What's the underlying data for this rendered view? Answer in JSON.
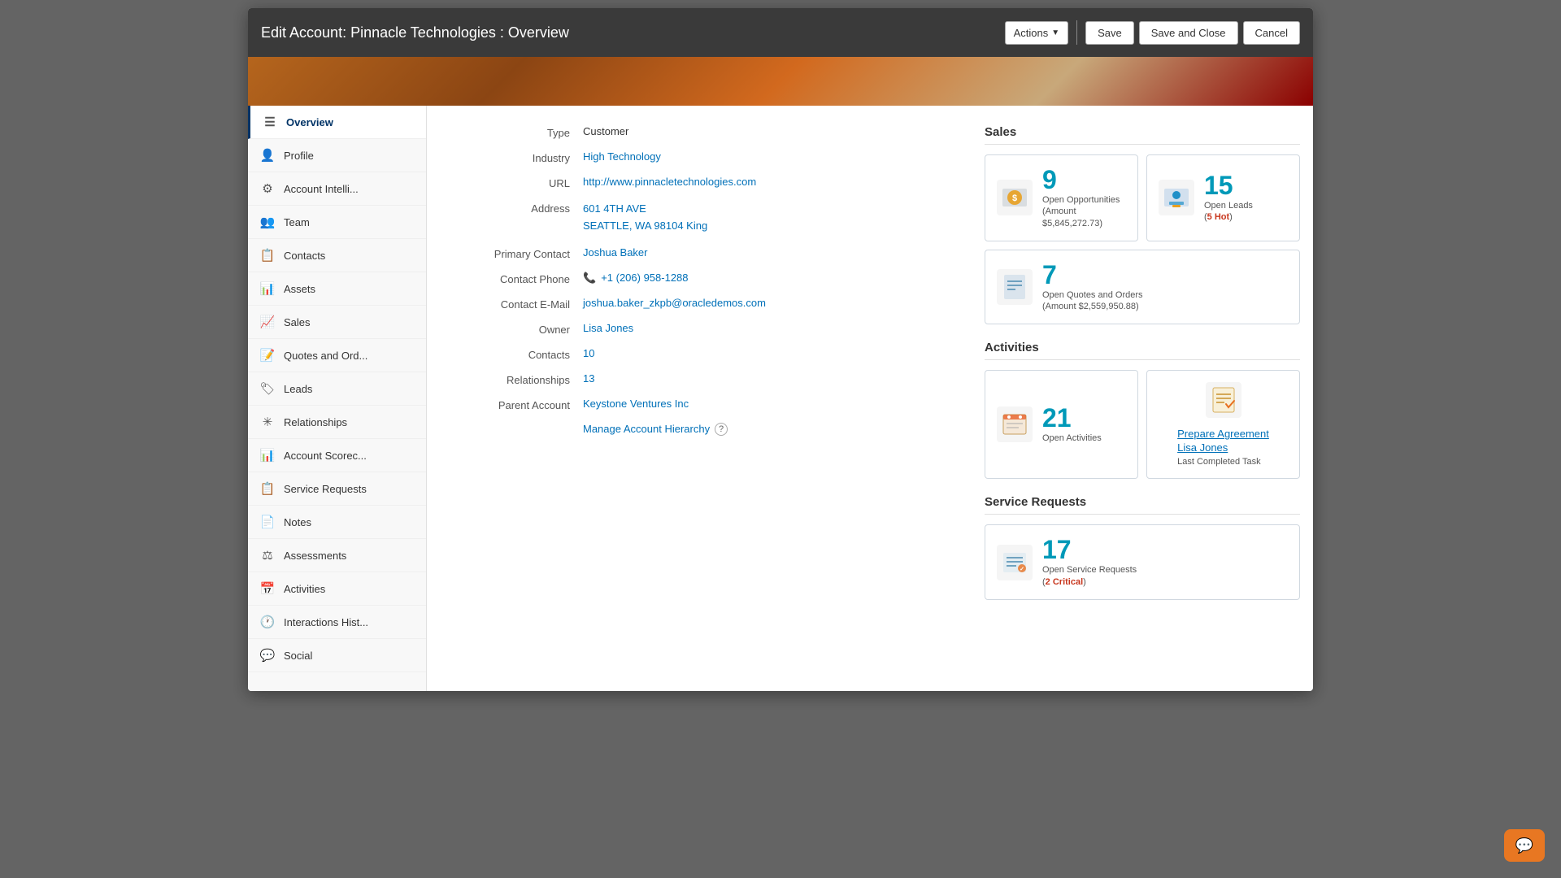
{
  "header": {
    "title": "Edit Account: Pinnacle Technologies : Overview",
    "actions_label": "Actions",
    "save_label": "Save",
    "save_close_label": "Save and Close",
    "cancel_label": "Cancel"
  },
  "sidebar": {
    "items": [
      {
        "id": "overview",
        "label": "Overview",
        "icon": "☰",
        "active": true
      },
      {
        "id": "profile",
        "label": "Profile",
        "icon": "👤"
      },
      {
        "id": "account-intelli",
        "label": "Account Intelli...",
        "icon": "⚙"
      },
      {
        "id": "team",
        "label": "Team",
        "icon": "👥"
      },
      {
        "id": "contacts",
        "label": "Contacts",
        "icon": "📋"
      },
      {
        "id": "assets",
        "label": "Assets",
        "icon": "📊"
      },
      {
        "id": "sales",
        "label": "Sales",
        "icon": "📈"
      },
      {
        "id": "quotes-orders",
        "label": "Quotes and Ord...",
        "icon": "📝"
      },
      {
        "id": "leads",
        "label": "Leads",
        "icon": "🏷"
      },
      {
        "id": "relationships",
        "label": "Relationships",
        "icon": "✳"
      },
      {
        "id": "account-scorec",
        "label": "Account Scorec...",
        "icon": "📊"
      },
      {
        "id": "service-requests",
        "label": "Service Requests",
        "icon": "📋"
      },
      {
        "id": "notes",
        "label": "Notes",
        "icon": "📄"
      },
      {
        "id": "assessments",
        "label": "Assessments",
        "icon": "⚖"
      },
      {
        "id": "activities",
        "label": "Activities",
        "icon": "📅"
      },
      {
        "id": "interactions-hist",
        "label": "Interactions Hist...",
        "icon": "🕐"
      },
      {
        "id": "social",
        "label": "Social",
        "icon": "💬"
      }
    ]
  },
  "fields": {
    "type_label": "Type",
    "type_value": "Customer",
    "industry_label": "Industry",
    "industry_value": "High Technology",
    "url_label": "URL",
    "url_value": "http://www.pinnacletechnologies.com",
    "address_label": "Address",
    "address_line1": "601 4TH AVE",
    "address_line2": "SEATTLE, WA 98104 King",
    "primary_contact_label": "Primary Contact",
    "primary_contact_value": "Joshua Baker",
    "contact_phone_label": "Contact Phone",
    "contact_phone_value": "+1 (206) 958-1288",
    "contact_email_label": "Contact E-Mail",
    "contact_email_value": "joshua.baker_zkpb@oracledemos.com",
    "owner_label": "Owner",
    "owner_value": "Lisa Jones",
    "contacts_label": "Contacts",
    "contacts_value": "10",
    "relationships_label": "Relationships",
    "relationships_value": "13",
    "parent_account_label": "Parent Account",
    "parent_account_value": "Keystone Ventures Inc",
    "manage_hierarchy_label": "Manage Account Hierarchy"
  },
  "sales_section": {
    "title": "Sales",
    "opp_count": "9",
    "opp_label": "Open Opportunities",
    "opp_sublabel": "(Amount $5,845,272.73)",
    "leads_count": "15",
    "leads_label": "Open Leads",
    "leads_sublabel": "(5 Hot)",
    "leads_hot": "5 Hot",
    "quotes_count": "7",
    "quotes_label": "Open Quotes and Orders",
    "quotes_sublabel": "(Amount $2,559,950.88)"
  },
  "activities_section": {
    "title": "Activities",
    "open_count": "21",
    "open_label": "Open Activities",
    "task_title": "Prepare Agreement",
    "task_owner": "Lisa Jones",
    "task_meta": "Last Completed Task"
  },
  "service_section": {
    "title": "Service Requests",
    "count": "17",
    "label": "Open Service Requests",
    "sublabel": "(2 Critical)",
    "critical": "2 Critical"
  }
}
